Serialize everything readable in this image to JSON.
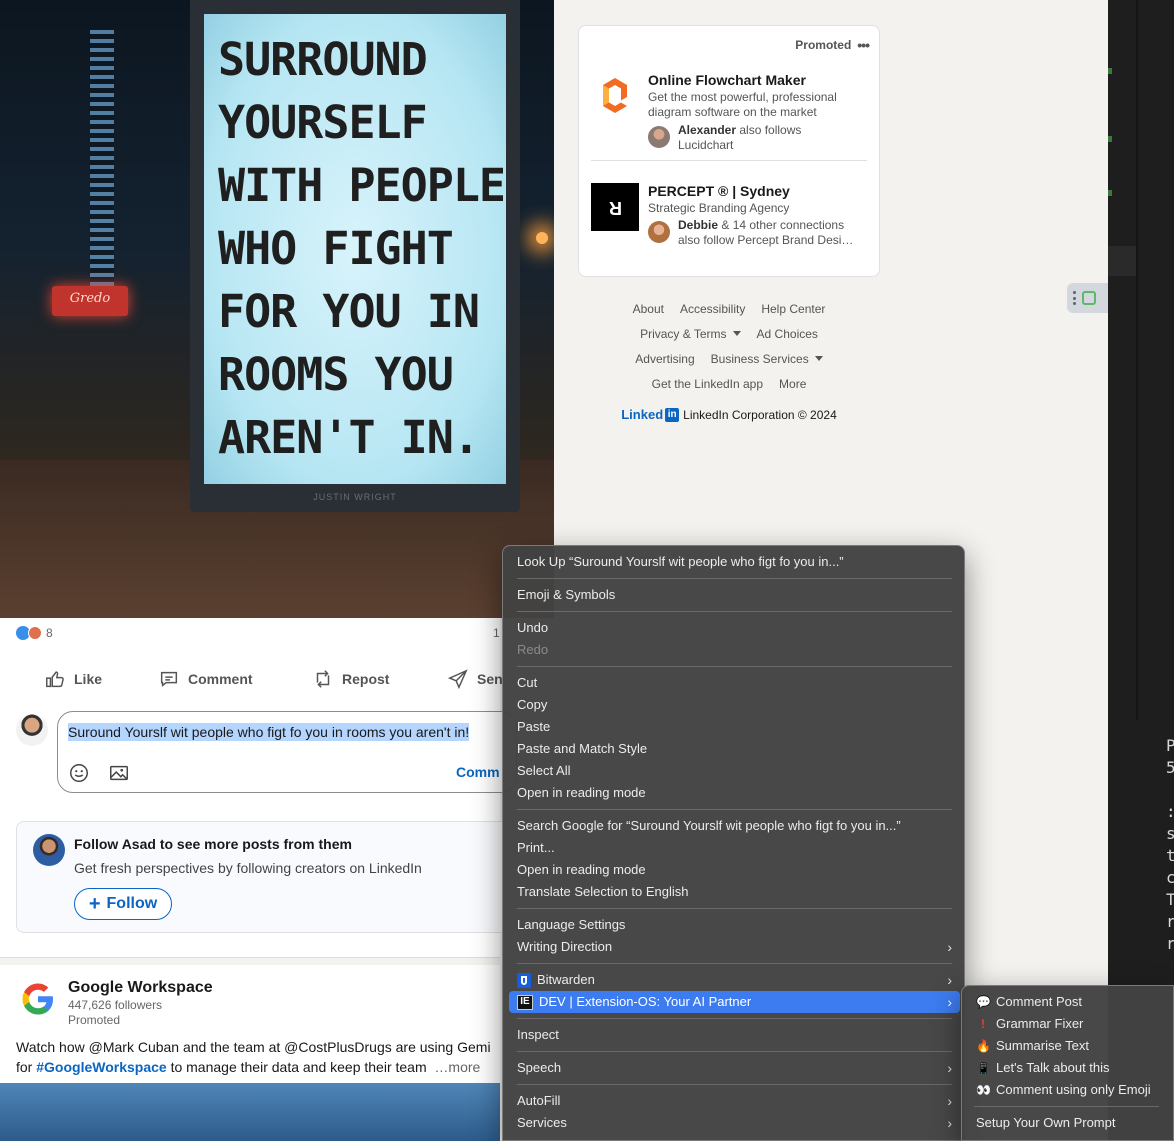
{
  "post": {
    "image_quote": "SURROUND\nYOURSELF\nWITH PEOPLE\nWHO FIGHT\nFOR YOU IN\nROOMS YOU\nAREN'T IN.",
    "image_credit": "JUSTIN WRIGHT",
    "shop_sign": "Gredo",
    "reaction_count": "8",
    "reaction_right": "1",
    "actions": {
      "like": "Like",
      "comment": "Comment",
      "repost": "Repost",
      "send": "Sen"
    },
    "comment_text": "Suround Yourslf wit people who figt fo you in rooms you aren't in!",
    "comment_submit": "Comm"
  },
  "follow_card": {
    "title": "Follow Asad to see more posts from them",
    "subtitle": "Get fresh perspectives by following creators on LinkedIn",
    "button": "Follow"
  },
  "post2": {
    "author": "Google Workspace",
    "followers": "447,626 followers",
    "promoted": "Promoted",
    "text_part1": "Watch how @Mark Cuban and the team at @CostPlusDrugs are using Gemi",
    "text_line2_prefix": "for ",
    "hashtag": "#GoogleWorkspace",
    "text_line2_rest": " to manage their data and keep their team",
    "more": "…more"
  },
  "promo": {
    "label": "Promoted",
    "items": [
      {
        "title": "Online Flowchart Maker",
        "desc": "Get the most powerful, professional diagram software on the market",
        "conn_name": "Alexander",
        "conn_text": " also follows Lucidchart"
      },
      {
        "title": "PERCEPT ® | Sydney",
        "desc": "Strategic Branding Agency",
        "conn_name": "Debbie",
        "conn_text": " & 14 other connections also follow Percept Brand Desi…"
      }
    ]
  },
  "footer": {
    "about": "About",
    "accessibility": "Accessibility",
    "help": "Help Center",
    "privacy": "Privacy & Terms",
    "ad_choices": "Ad Choices",
    "advertising": "Advertising",
    "business": "Business Services",
    "app": "Get the LinkedIn app",
    "more": "More",
    "brand_word": "Linked",
    "brand_box": "in",
    "copyright": "LinkedIn Corporation © 2024"
  },
  "context_menu": {
    "look_up": "Look Up “Suround Yourslf wit people who figt fo you in...”",
    "emoji": "Emoji & Symbols",
    "undo": "Undo",
    "redo": "Redo",
    "cut": "Cut",
    "copy": "Copy",
    "paste": "Paste",
    "paste_match": "Paste and Match Style",
    "select_all": "Select All",
    "reading_mode": "Open in reading mode",
    "search_google": "Search Google for “Suround Yourslf wit people who figt fo you in...”",
    "print": "Print...",
    "reading_mode2": "Open in reading mode",
    "translate": "Translate Selection to English",
    "language": "Language Settings",
    "writing_dir": "Writing Direction",
    "bitwarden": "Bitwarden",
    "dev_ext": "DEV | Extension-OS: Your AI Partner",
    "inspect": "Inspect",
    "speech": "Speech",
    "autofill": "AutoFill",
    "services": "Services"
  },
  "submenu": {
    "comment_post": "Comment Post",
    "grammar": "Grammar Fixer",
    "summarise": "Summarise Text",
    "talk": "Let's Talk about this",
    "emoji_only": "Comment using only Emoji",
    "setup": "Setup Your Own Prompt"
  },
  "dark_panel_chars": "P\n5\n\n:\ns\nt\nc\nT\nr\nr"
}
